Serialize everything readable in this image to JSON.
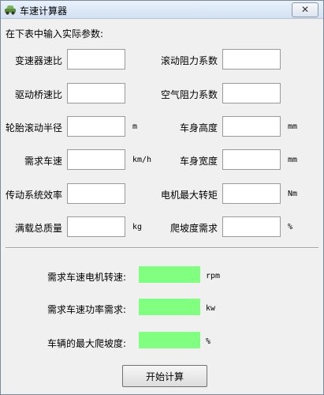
{
  "window": {
    "title": "车速计算器",
    "close_glyph": "✕"
  },
  "instructions": "在下表中输入实际参数:",
  "left_params": [
    {
      "label": "变速器速比",
      "unit": ""
    },
    {
      "label": "驱动桥速比",
      "unit": ""
    },
    {
      "label": "轮胎滚动半径",
      "unit": "m"
    },
    {
      "label": "需求车速",
      "unit": "km/h"
    },
    {
      "label": "传动系统效率",
      "unit": ""
    },
    {
      "label": "满载总质量",
      "unit": "kg"
    }
  ],
  "right_params": [
    {
      "label": "滚动阻力系数",
      "unit": ""
    },
    {
      "label": "空气阻力系数",
      "unit": ""
    },
    {
      "label": "车身高度",
      "unit": "mm"
    },
    {
      "label": "车身宽度",
      "unit": "mm"
    },
    {
      "label": "电机最大转矩",
      "unit": "Nm"
    },
    {
      "label": "爬坡度需求",
      "unit": "%"
    }
  ],
  "results": [
    {
      "label": "需求车速电机转速:",
      "unit": "rpm",
      "value": ""
    },
    {
      "label": "需求车速功率需求:",
      "unit": "kw",
      "value": ""
    },
    {
      "label": "车辆的最大爬坡度:",
      "unit": "%",
      "value": ""
    }
  ],
  "start_button": "开始计算",
  "colors": {
    "result_field": "#80ff80",
    "titlebar": "#dbe7f5"
  },
  "icons": {
    "app": "car-icon",
    "close": "close-icon"
  }
}
